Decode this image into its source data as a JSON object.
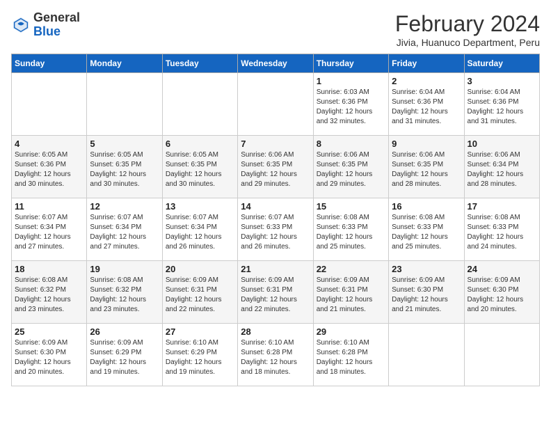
{
  "header": {
    "logo_general": "General",
    "logo_blue": "Blue",
    "month_title": "February 2024",
    "location": "Jivia, Huanuco Department, Peru"
  },
  "days_of_week": [
    "Sunday",
    "Monday",
    "Tuesday",
    "Wednesday",
    "Thursday",
    "Friday",
    "Saturday"
  ],
  "weeks": [
    [
      {
        "day": "",
        "info": ""
      },
      {
        "day": "",
        "info": ""
      },
      {
        "day": "",
        "info": ""
      },
      {
        "day": "",
        "info": ""
      },
      {
        "day": "1",
        "info": "Sunrise: 6:03 AM\nSunset: 6:36 PM\nDaylight: 12 hours\nand 32 minutes."
      },
      {
        "day": "2",
        "info": "Sunrise: 6:04 AM\nSunset: 6:36 PM\nDaylight: 12 hours\nand 31 minutes."
      },
      {
        "day": "3",
        "info": "Sunrise: 6:04 AM\nSunset: 6:36 PM\nDaylight: 12 hours\nand 31 minutes."
      }
    ],
    [
      {
        "day": "4",
        "info": "Sunrise: 6:05 AM\nSunset: 6:36 PM\nDaylight: 12 hours\nand 30 minutes."
      },
      {
        "day": "5",
        "info": "Sunrise: 6:05 AM\nSunset: 6:35 PM\nDaylight: 12 hours\nand 30 minutes."
      },
      {
        "day": "6",
        "info": "Sunrise: 6:05 AM\nSunset: 6:35 PM\nDaylight: 12 hours\nand 30 minutes."
      },
      {
        "day": "7",
        "info": "Sunrise: 6:06 AM\nSunset: 6:35 PM\nDaylight: 12 hours\nand 29 minutes."
      },
      {
        "day": "8",
        "info": "Sunrise: 6:06 AM\nSunset: 6:35 PM\nDaylight: 12 hours\nand 29 minutes."
      },
      {
        "day": "9",
        "info": "Sunrise: 6:06 AM\nSunset: 6:35 PM\nDaylight: 12 hours\nand 28 minutes."
      },
      {
        "day": "10",
        "info": "Sunrise: 6:06 AM\nSunset: 6:34 PM\nDaylight: 12 hours\nand 28 minutes."
      }
    ],
    [
      {
        "day": "11",
        "info": "Sunrise: 6:07 AM\nSunset: 6:34 PM\nDaylight: 12 hours\nand 27 minutes."
      },
      {
        "day": "12",
        "info": "Sunrise: 6:07 AM\nSunset: 6:34 PM\nDaylight: 12 hours\nand 27 minutes."
      },
      {
        "day": "13",
        "info": "Sunrise: 6:07 AM\nSunset: 6:34 PM\nDaylight: 12 hours\nand 26 minutes."
      },
      {
        "day": "14",
        "info": "Sunrise: 6:07 AM\nSunset: 6:33 PM\nDaylight: 12 hours\nand 26 minutes."
      },
      {
        "day": "15",
        "info": "Sunrise: 6:08 AM\nSunset: 6:33 PM\nDaylight: 12 hours\nand 25 minutes."
      },
      {
        "day": "16",
        "info": "Sunrise: 6:08 AM\nSunset: 6:33 PM\nDaylight: 12 hours\nand 25 minutes."
      },
      {
        "day": "17",
        "info": "Sunrise: 6:08 AM\nSunset: 6:33 PM\nDaylight: 12 hours\nand 24 minutes."
      }
    ],
    [
      {
        "day": "18",
        "info": "Sunrise: 6:08 AM\nSunset: 6:32 PM\nDaylight: 12 hours\nand 23 minutes."
      },
      {
        "day": "19",
        "info": "Sunrise: 6:08 AM\nSunset: 6:32 PM\nDaylight: 12 hours\nand 23 minutes."
      },
      {
        "day": "20",
        "info": "Sunrise: 6:09 AM\nSunset: 6:31 PM\nDaylight: 12 hours\nand 22 minutes."
      },
      {
        "day": "21",
        "info": "Sunrise: 6:09 AM\nSunset: 6:31 PM\nDaylight: 12 hours\nand 22 minutes."
      },
      {
        "day": "22",
        "info": "Sunrise: 6:09 AM\nSunset: 6:31 PM\nDaylight: 12 hours\nand 21 minutes."
      },
      {
        "day": "23",
        "info": "Sunrise: 6:09 AM\nSunset: 6:30 PM\nDaylight: 12 hours\nand 21 minutes."
      },
      {
        "day": "24",
        "info": "Sunrise: 6:09 AM\nSunset: 6:30 PM\nDaylight: 12 hours\nand 20 minutes."
      }
    ],
    [
      {
        "day": "25",
        "info": "Sunrise: 6:09 AM\nSunset: 6:30 PM\nDaylight: 12 hours\nand 20 minutes."
      },
      {
        "day": "26",
        "info": "Sunrise: 6:09 AM\nSunset: 6:29 PM\nDaylight: 12 hours\nand 19 minutes."
      },
      {
        "day": "27",
        "info": "Sunrise: 6:10 AM\nSunset: 6:29 PM\nDaylight: 12 hours\nand 19 minutes."
      },
      {
        "day": "28",
        "info": "Sunrise: 6:10 AM\nSunset: 6:28 PM\nDaylight: 12 hours\nand 18 minutes."
      },
      {
        "day": "29",
        "info": "Sunrise: 6:10 AM\nSunset: 6:28 PM\nDaylight: 12 hours\nand 18 minutes."
      },
      {
        "day": "",
        "info": ""
      },
      {
        "day": "",
        "info": ""
      }
    ]
  ]
}
